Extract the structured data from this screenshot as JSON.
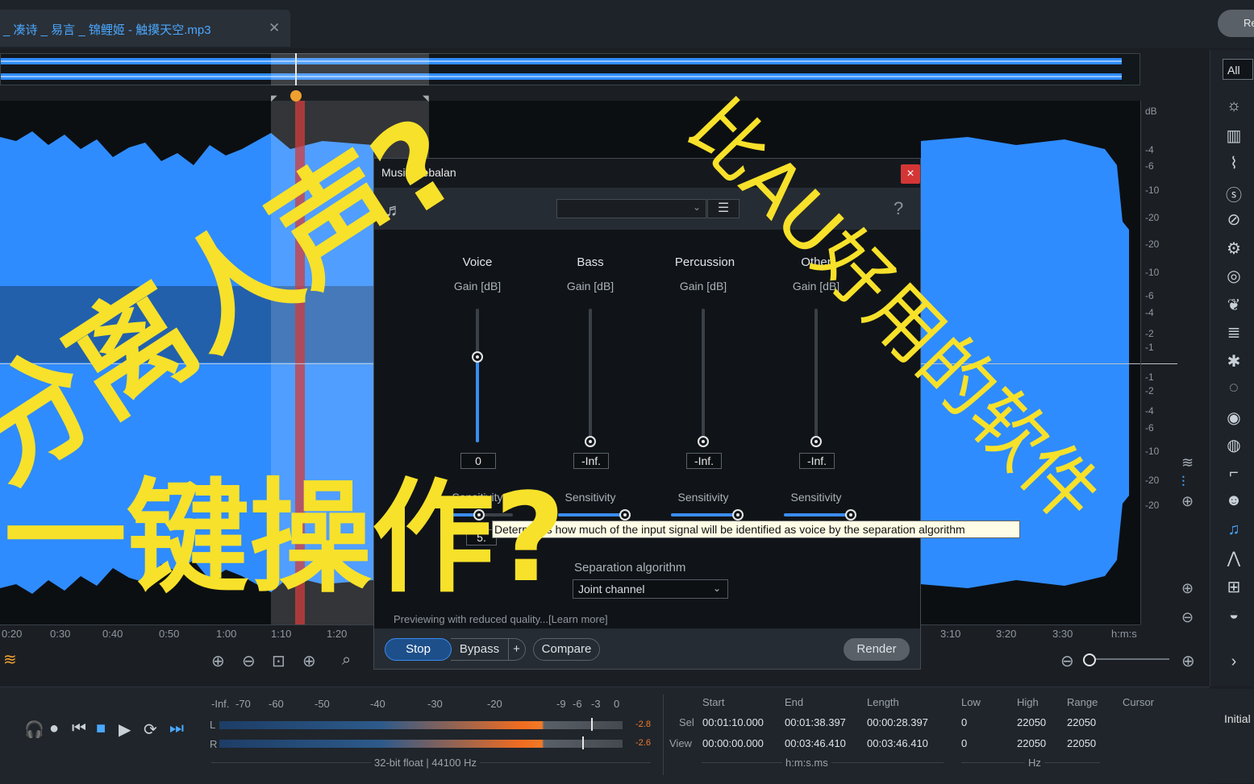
{
  "tab": {
    "title": "_ 凑诗 _ 易言 _ 锦鲤姬 - 触摸天空.mp3",
    "close": "✕",
    "right_button": "Re"
  },
  "ruler": {
    "ticks": [
      "0:20",
      "0:30",
      "0:40",
      "0:50",
      "1:00",
      "1:10",
      "1:20",
      "3:10",
      "3:20",
      "3:30",
      "h:m:s"
    ]
  },
  "db_scale": [
    "dB",
    "-4",
    "-6",
    "-10",
    "-20",
    "-20",
    "-10",
    "-6",
    "-4",
    "-2",
    "-1",
    "-1",
    "-2",
    "-4",
    "-6",
    "-10",
    "-20",
    "-20"
  ],
  "sidebar": {
    "filter": "All",
    "initial": "Initial"
  },
  "dialog": {
    "title": "Music Rebalan",
    "close": "×",
    "help": "?",
    "columns": [
      {
        "name": "Voice",
        "gain_label": "Gain [dB]",
        "value": "0",
        "sensitivity": "Sensitivity",
        "sens_value": "5."
      },
      {
        "name": "Bass",
        "gain_label": "Gain [dB]",
        "value": "-Inf.",
        "sensitivity": "Sensitivity"
      },
      {
        "name": "Percussion",
        "gain_label": "Gain [dB]",
        "value": "-Inf.",
        "sensitivity": "Sensitivity"
      },
      {
        "name": "Other",
        "gain_label": "Gain [dB]",
        "value": "-Inf.",
        "sensitivity": "Sensitivity"
      }
    ],
    "tooltip": "Determines how much of the input signal will be identified as voice by the separation algorithm",
    "separation_label": "Separation algorithm",
    "separation_value": "Joint channel",
    "preview_text": "Previewing with reduced quality...[Learn more]",
    "buttons": {
      "stop": "Stop",
      "bypass": "Bypass",
      "plus": "+",
      "compare": "Compare",
      "render": "Render"
    }
  },
  "meter": {
    "scale": [
      "-Inf.",
      "-70",
      "-60",
      "-50",
      "-40",
      "-30",
      "-20",
      "-9",
      "-6",
      "-3",
      "0"
    ],
    "left_label": "L",
    "right_label": "R",
    "left_peak": "-2.8",
    "right_peak": "-2.6",
    "format": "32-bit float | 44100 Hz"
  },
  "selection": {
    "headers": {
      "start": "Start",
      "end": "End",
      "length": "Length",
      "low": "Low",
      "high": "High",
      "range": "Range",
      "cursor": "Cursor"
    },
    "sel_label": "Sel",
    "view_label": "View",
    "sel": {
      "start": "00:01:10.000",
      "end": "00:01:38.397",
      "length": "00:00:28.397",
      "low": "0",
      "high": "22050",
      "range": "22050"
    },
    "view": {
      "start": "00:00:00.000",
      "end": "00:03:46.410",
      "length": "00:03:46.410",
      "low": "0",
      "high": "22050",
      "range": "22050"
    },
    "time_unit": "h:m:s.ms",
    "freq_unit": "Hz"
  },
  "overlay": {
    "line1": "分离人声?",
    "line2": "一键操作?",
    "line3": "比AU好用的软件"
  }
}
